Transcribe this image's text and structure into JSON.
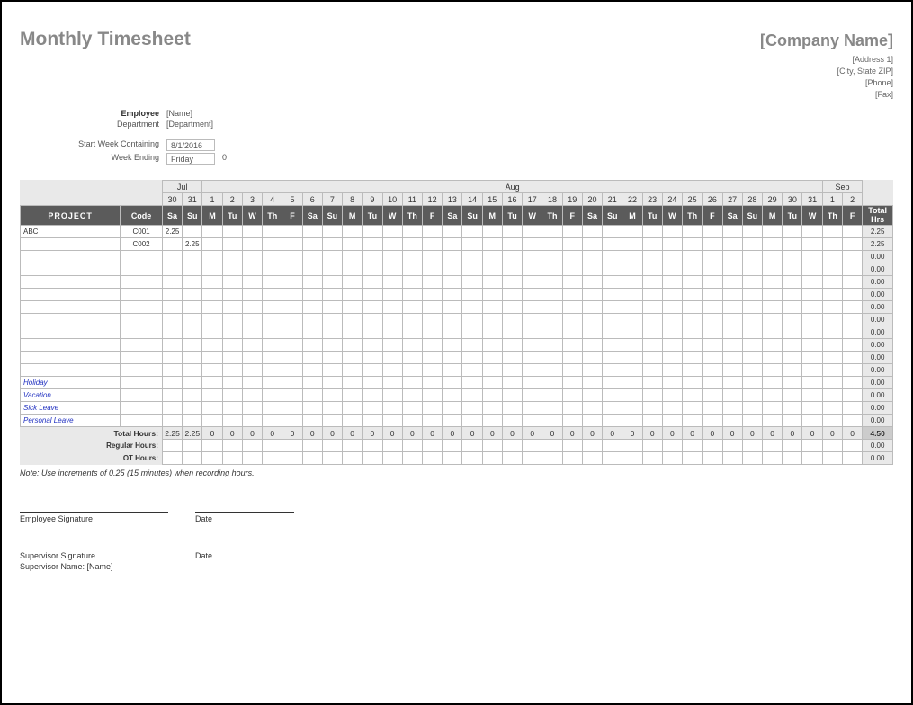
{
  "title": "Monthly Timesheet",
  "company": {
    "name": "[Company Name]",
    "address1": "[Address 1]",
    "city": "[City, State ZIP]",
    "phone": "[Phone]",
    "fax": "[Fax]"
  },
  "meta": {
    "employee_label": "Employee",
    "employee_value": "[Name]",
    "department_label": "Department",
    "department_value": "[Department]",
    "start_label": "Start Week Containing",
    "start_value": "8/1/2016",
    "weekending_label": "Week Ending",
    "weekending_value": "Friday",
    "weekending_extra": "0"
  },
  "months": [
    {
      "label": "Jul",
      "span": 2,
      "at": 0
    },
    {
      "label": "Aug",
      "span": 31,
      "at": 2
    },
    {
      "label": "Sep",
      "span": 2,
      "at": 33
    }
  ],
  "dates": [
    "30",
    "31",
    "1",
    "2",
    "3",
    "4",
    "5",
    "6",
    "7",
    "8",
    "9",
    "10",
    "11",
    "12",
    "13",
    "14",
    "15",
    "16",
    "17",
    "18",
    "19",
    "20",
    "21",
    "22",
    "23",
    "24",
    "25",
    "26",
    "27",
    "28",
    "29",
    "30",
    "31",
    "1",
    "2"
  ],
  "days": [
    "Sa",
    "Su",
    "M",
    "Tu",
    "W",
    "Th",
    "F",
    "Sa",
    "Su",
    "M",
    "Tu",
    "W",
    "Th",
    "F",
    "Sa",
    "Su",
    "M",
    "Tu",
    "W",
    "Th",
    "F",
    "Sa",
    "Su",
    "M",
    "Tu",
    "W",
    "Th",
    "F",
    "Sa",
    "Su",
    "M",
    "Tu",
    "W",
    "Th",
    "F"
  ],
  "headers": {
    "project": "PROJECT",
    "code": "Code",
    "total": "Total\nHrs"
  },
  "rows": [
    {
      "project": "ABC",
      "code": "C001",
      "cells": [
        "2.25",
        "",
        "",
        "",
        "",
        "",
        "",
        "",
        "",
        "",
        "",
        "",
        "",
        "",
        "",
        "",
        "",
        "",
        "",
        "",
        "",
        "",
        "",
        "",
        "",
        "",
        "",
        "",
        "",
        "",
        "",
        "",
        "",
        "",
        ""
      ],
      "total": "2.25"
    },
    {
      "project": "",
      "code": "C002",
      "cells": [
        "",
        "2.25",
        "",
        "",
        "",
        "",
        "",
        "",
        "",
        "",
        "",
        "",
        "",
        "",
        "",
        "",
        "",
        "",
        "",
        "",
        "",
        "",
        "",
        "",
        "",
        "",
        "",
        "",
        "",
        "",
        "",
        "",
        "",
        "",
        ""
      ],
      "total": "2.25"
    },
    {
      "project": "",
      "code": "",
      "cells": [],
      "total": "0.00"
    },
    {
      "project": "",
      "code": "",
      "cells": [],
      "total": "0.00"
    },
    {
      "project": "",
      "code": "",
      "cells": [],
      "total": "0.00"
    },
    {
      "project": "",
      "code": "",
      "cells": [],
      "total": "0.00"
    },
    {
      "project": "",
      "code": "",
      "cells": [],
      "total": "0.00"
    },
    {
      "project": "",
      "code": "",
      "cells": [],
      "total": "0.00"
    },
    {
      "project": "",
      "code": "",
      "cells": [],
      "total": "0.00"
    },
    {
      "project": "",
      "code": "",
      "cells": [],
      "total": "0.00"
    },
    {
      "project": "",
      "code": "",
      "cells": [],
      "total": "0.00"
    },
    {
      "project": "",
      "code": "",
      "cells": [],
      "total": "0.00"
    }
  ],
  "leave_rows": [
    {
      "project": "Holiday",
      "total": "0.00"
    },
    {
      "project": "Vacation",
      "total": "0.00"
    },
    {
      "project": "Sick Leave",
      "total": "0.00"
    },
    {
      "project": "Personal Leave",
      "total": "0.00"
    }
  ],
  "totals": {
    "label": "Total Hours:",
    "values": [
      "2.25",
      "2.25",
      "0",
      "0",
      "0",
      "0",
      "0",
      "0",
      "0",
      "0",
      "0",
      "0",
      "0",
      "0",
      "0",
      "0",
      "0",
      "0",
      "0",
      "0",
      "0",
      "0",
      "0",
      "0",
      "0",
      "0",
      "0",
      "0",
      "0",
      "0",
      "0",
      "0",
      "0",
      "0",
      "0"
    ],
    "grand": "4.50"
  },
  "regular": {
    "label": "Regular Hours:",
    "grand": "0.00"
  },
  "ot": {
    "label": "OT Hours:",
    "grand": "0.00"
  },
  "note": "Note: Use increments of 0.25 (15 minutes) when recording hours.",
  "sig": {
    "emp": "Employee Signature",
    "date": "Date",
    "sup": "Supervisor Signature",
    "supname_label": "Supervisor Name: [Name]"
  }
}
